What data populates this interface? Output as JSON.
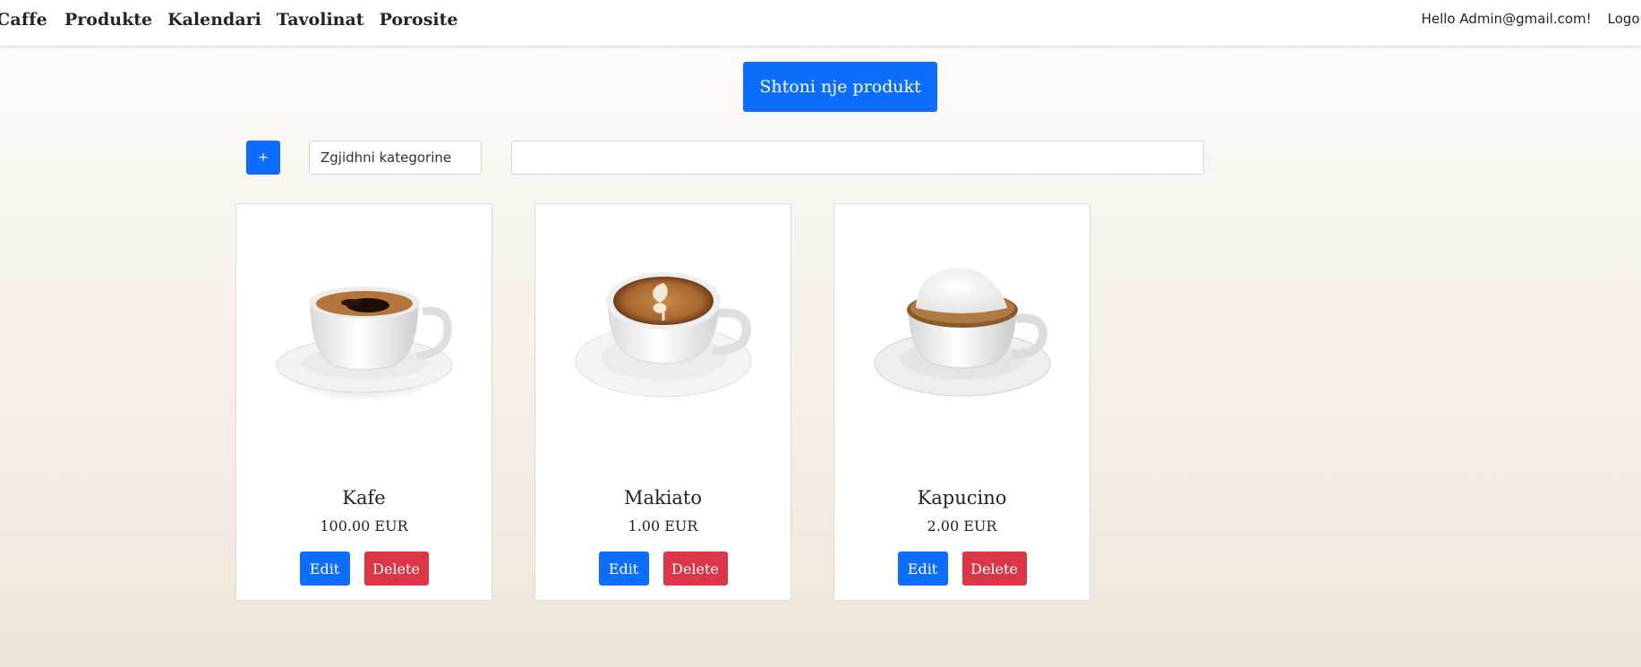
{
  "navbar": {
    "brand": "Caffe",
    "links": [
      "Produkte",
      "Kalendari",
      "Tavolinat",
      "Porosite"
    ],
    "greeting": "Hello Admin@gmail.com!",
    "logout": "Logout"
  },
  "toolbar": {
    "add_product_label": "Shtoni nje produkt",
    "plus_label": "+",
    "category_placeholder": "Zgjidhni kategorine",
    "search_value": ""
  },
  "colors": {
    "primary": "#0d6efd",
    "danger": "#dc3545",
    "background_top": "#ffffff",
    "background_bottom": "#efe6da"
  },
  "products": [
    {
      "name": "Kafe",
      "price": "100.00 EUR",
      "image": "espresso-cup-icon",
      "edit_label": "Edit",
      "delete_label": "Delete"
    },
    {
      "name": "Makiato",
      "price": "1.00 EUR",
      "image": "latte-art-cup-icon",
      "edit_label": "Edit",
      "delete_label": "Delete"
    },
    {
      "name": "Kapucino",
      "price": "2.00 EUR",
      "image": "cappuccino-foam-cup-icon",
      "edit_label": "Edit",
      "delete_label": "Delete"
    }
  ]
}
